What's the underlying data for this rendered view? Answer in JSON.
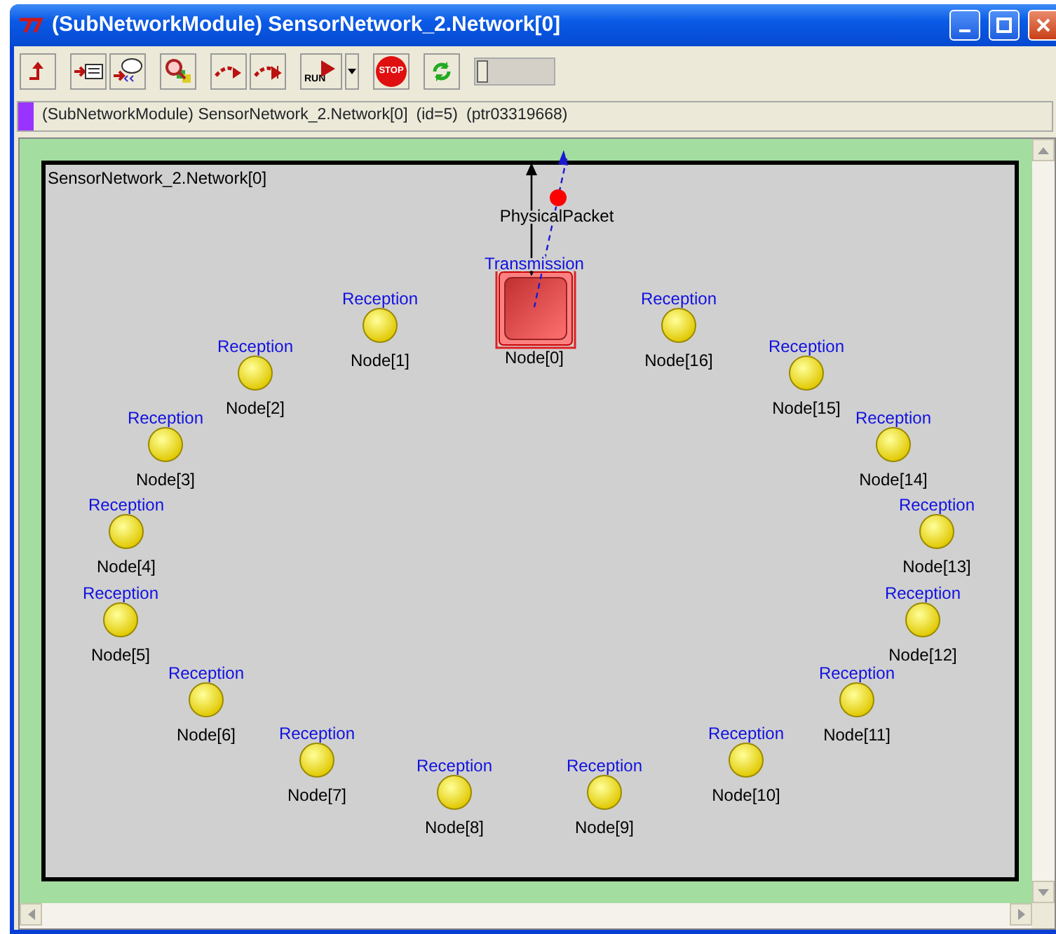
{
  "window": {
    "title": "(SubNetworkModule) SensorNetwork_2.Network[0]"
  },
  "toolbar": {
    "run_label": "RUN",
    "stop_label": "STOP"
  },
  "info_bar": {
    "class_and_path": "(SubNetworkModule) SensorNetwork_2.Network[0]",
    "id": "(id=5)",
    "pointer": "(ptr03319668)"
  },
  "canvas": {
    "module_name": "SensorNetwork_2.Network[0]",
    "message": {
      "name": "PhysicalPacket"
    },
    "nodes": [
      {
        "name": "Node[1]",
        "status": "Reception",
        "kind": "receiver"
      },
      {
        "name": "Node[0]",
        "status": "Transmission",
        "kind": "transmitter"
      },
      {
        "name": "Node[16]",
        "status": "Reception",
        "kind": "receiver"
      },
      {
        "name": "Node[2]",
        "status": "Reception",
        "kind": "receiver"
      },
      {
        "name": "Node[15]",
        "status": "Reception",
        "kind": "receiver"
      },
      {
        "name": "Node[3]",
        "status": "Reception",
        "kind": "receiver"
      },
      {
        "name": "Node[14]",
        "status": "Reception",
        "kind": "receiver"
      },
      {
        "name": "Node[4]",
        "status": "Reception",
        "kind": "receiver"
      },
      {
        "name": "Node[13]",
        "status": "Reception",
        "kind": "receiver"
      },
      {
        "name": "Node[5]",
        "status": "Reception",
        "kind": "receiver"
      },
      {
        "name": "Node[12]",
        "status": "Reception",
        "kind": "receiver"
      },
      {
        "name": "Node[6]",
        "status": "Reception",
        "kind": "receiver"
      },
      {
        "name": "Node[11]",
        "status": "Reception",
        "kind": "receiver"
      },
      {
        "name": "Node[7]",
        "status": "Reception",
        "kind": "receiver"
      },
      {
        "name": "Node[10]",
        "status": "Reception",
        "kind": "receiver"
      },
      {
        "name": "Node[8]",
        "status": "Reception",
        "kind": "receiver"
      },
      {
        "name": "Node[9]",
        "status": "Reception",
        "kind": "receiver"
      }
    ]
  }
}
